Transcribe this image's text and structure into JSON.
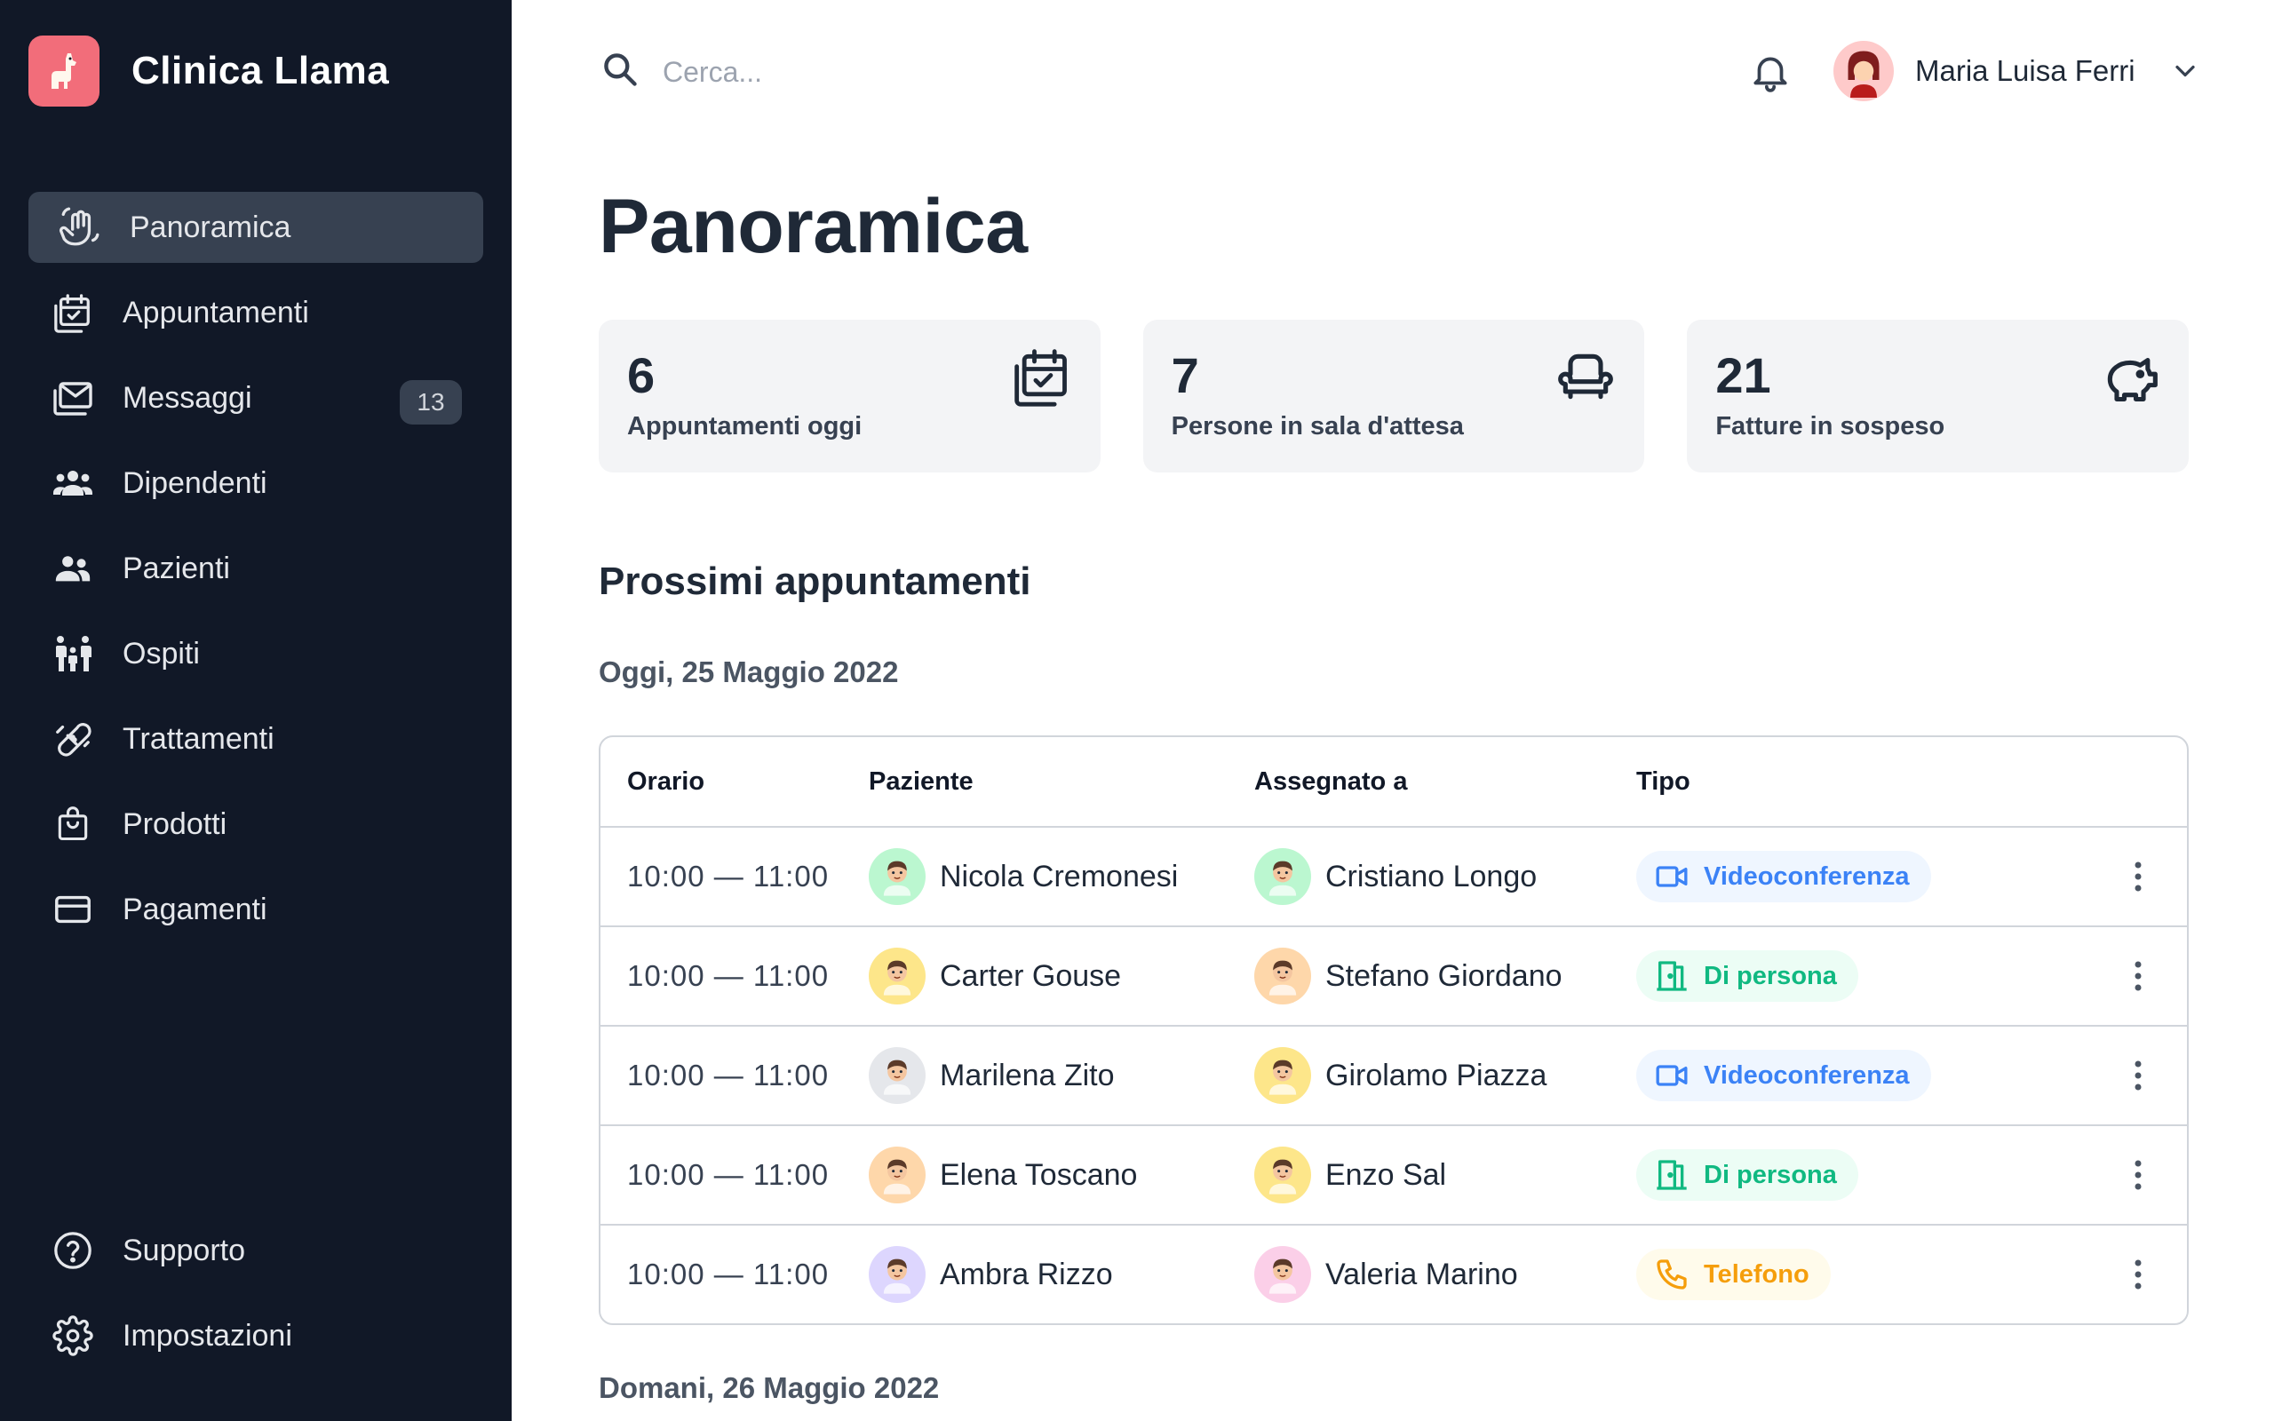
{
  "brand": {
    "name": "Clinica Llama",
    "logo_icon": "llama-icon",
    "logo_color": "#f26d7a"
  },
  "sidebar": {
    "items": [
      {
        "label": "Panoramica",
        "icon": "waving-hand-icon",
        "active": true
      },
      {
        "label": "Appuntamenti",
        "icon": "calendar-check-icon"
      },
      {
        "label": "Messaggi",
        "icon": "mail-icon",
        "badge": "13"
      },
      {
        "label": "Dipendenti",
        "icon": "group-icon"
      },
      {
        "label": "Pazienti",
        "icon": "people-icon"
      },
      {
        "label": "Ospiti",
        "icon": "family-icon"
      },
      {
        "label": "Trattamenti",
        "icon": "bandage-icon"
      },
      {
        "label": "Prodotti",
        "icon": "shopping-bag-icon"
      },
      {
        "label": "Pagamenti",
        "icon": "credit-card-icon"
      }
    ],
    "bottom_items": [
      {
        "label": "Supporto",
        "icon": "help-icon"
      },
      {
        "label": "Impostazioni",
        "icon": "gear-icon"
      }
    ]
  },
  "topbar": {
    "search_placeholder": "Cerca...",
    "user_name": "Maria Luisa Ferri"
  },
  "page": {
    "title": "Panoramica"
  },
  "stats": [
    {
      "value": "6",
      "label": "Appuntamenti oggi",
      "icon": "calendar-check-icon"
    },
    {
      "value": "7",
      "label": "Persone in sala d'attesa",
      "icon": "armchair-icon"
    },
    {
      "value": "21",
      "label": "Fatture in sospeso",
      "icon": "piggy-bank-icon"
    }
  ],
  "appointments": {
    "section_title": "Prossimi appuntamenti",
    "today_heading": "Oggi, 25 Maggio 2022",
    "tomorrow_heading": "Domani, 26 Maggio 2022",
    "columns": [
      "Orario",
      "Paziente",
      "Assegnato a",
      "Tipo"
    ],
    "rows": [
      {
        "time": "10:00 — 11:00",
        "patient": "Nicola Cremonesi",
        "patient_avatar_color": "#bbf7d0",
        "assigned": "Cristiano Longo",
        "assigned_avatar_color": "#bbf7d0",
        "type": "Videoconferenza",
        "type_kind": "video"
      },
      {
        "time": "10:00 — 11:00",
        "patient": "Carter Gouse",
        "patient_avatar_color": "#fde68a",
        "assigned": "Stefano Giordano",
        "assigned_avatar_color": "#fed7aa",
        "type": "Di persona",
        "type_kind": "person"
      },
      {
        "time": "10:00 — 11:00",
        "patient": "Marilena Zito",
        "patient_avatar_color": "#e5e7eb",
        "assigned": "Girolamo Piazza",
        "assigned_avatar_color": "#fde68a",
        "type": "Videoconferenza",
        "type_kind": "video"
      },
      {
        "time": "10:00 — 11:00",
        "patient": "Elena Toscano",
        "patient_avatar_color": "#fed7aa",
        "assigned": "Enzo Sal",
        "assigned_avatar_color": "#fde68a",
        "type": "Di persona",
        "type_kind": "person"
      },
      {
        "time": "10:00 — 11:00",
        "patient": "Ambra Rizzo",
        "patient_avatar_color": "#ddd6fe",
        "assigned": "Valeria Marino",
        "assigned_avatar_color": "#fbcfe8",
        "type": "Telefono",
        "type_kind": "phone"
      }
    ]
  }
}
